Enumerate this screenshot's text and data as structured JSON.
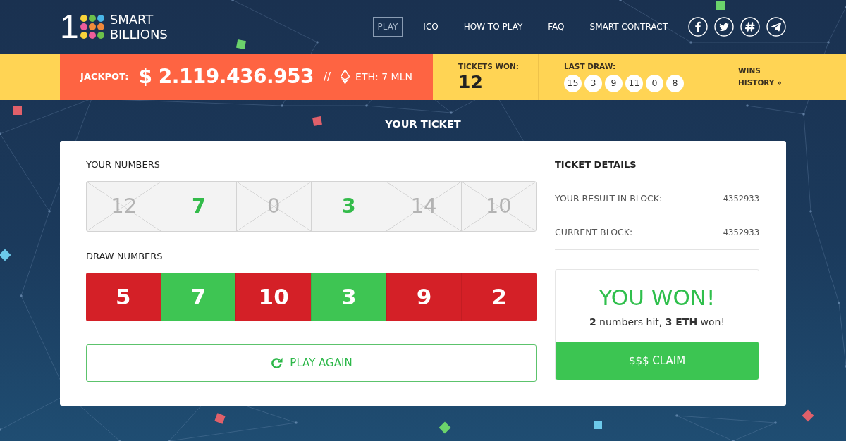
{
  "logo": {
    "numeral": "1",
    "name_lines": [
      "SMART",
      "BILLIONS"
    ]
  },
  "nav": [
    {
      "label": "PLAY",
      "selected": true
    },
    {
      "label": "ICO",
      "selected": false
    },
    {
      "label": "HOW TO PLAY",
      "selected": false
    },
    {
      "label": "FAQ",
      "selected": false
    },
    {
      "label": "SMART CONTRACT",
      "selected": false
    }
  ],
  "social_links": [
    {
      "kind": "f"
    },
    {
      "kind": "bird"
    },
    {
      "kind": "hash"
    },
    {
      "kind": "plane"
    }
  ],
  "jackpot": {
    "label": "JACKPOT:",
    "amount": "$ 2.119.436.953",
    "separator": "//",
    "eth": "ETH: 7 MLN"
  },
  "tickets_won": {
    "label": "TICKETS WON:",
    "value": "12"
  },
  "last_draw": {
    "label": "LAST DRAW:",
    "balls": [
      "15",
      "3",
      "9",
      "11",
      "0",
      "8"
    ]
  },
  "wins_history": {
    "lines": [
      "WINS",
      "HISTORY »"
    ]
  },
  "section_title": "YOUR TICKET",
  "ticket": {
    "your_numbers": {
      "label": "YOUR NUMBERS",
      "numbers": [
        {
          "value": "12",
          "hit": false
        },
        {
          "value": "7",
          "hit": true
        },
        {
          "value": "0",
          "hit": false
        },
        {
          "value": "3",
          "hit": true
        },
        {
          "value": "14",
          "hit": false
        },
        {
          "value": "10",
          "hit": false
        }
      ]
    },
    "draw_numbers": {
      "label": "DRAW NUMBERS",
      "numbers": [
        {
          "value": "5",
          "hit": false
        },
        {
          "value": "7",
          "hit": true
        },
        {
          "value": "10",
          "hit": false
        },
        {
          "value": "3",
          "hit": true
        },
        {
          "value": "9",
          "hit": false
        },
        {
          "value": "2",
          "hit": false
        }
      ]
    },
    "play_again": "PLAY AGAIN"
  },
  "details": {
    "title": "TICKET DETAILS",
    "rows": [
      {
        "label": "YOUR RESULT IN BLOCK:",
        "value": "4352933"
      },
      {
        "label": "CURRENT BLOCK:",
        "value": "4352933"
      }
    ]
  },
  "result": {
    "headline": "YOU WON!",
    "summary": "**2** numbers hit, **3 ETH** won!",
    "claim": "$$$ CLAIM"
  }
}
